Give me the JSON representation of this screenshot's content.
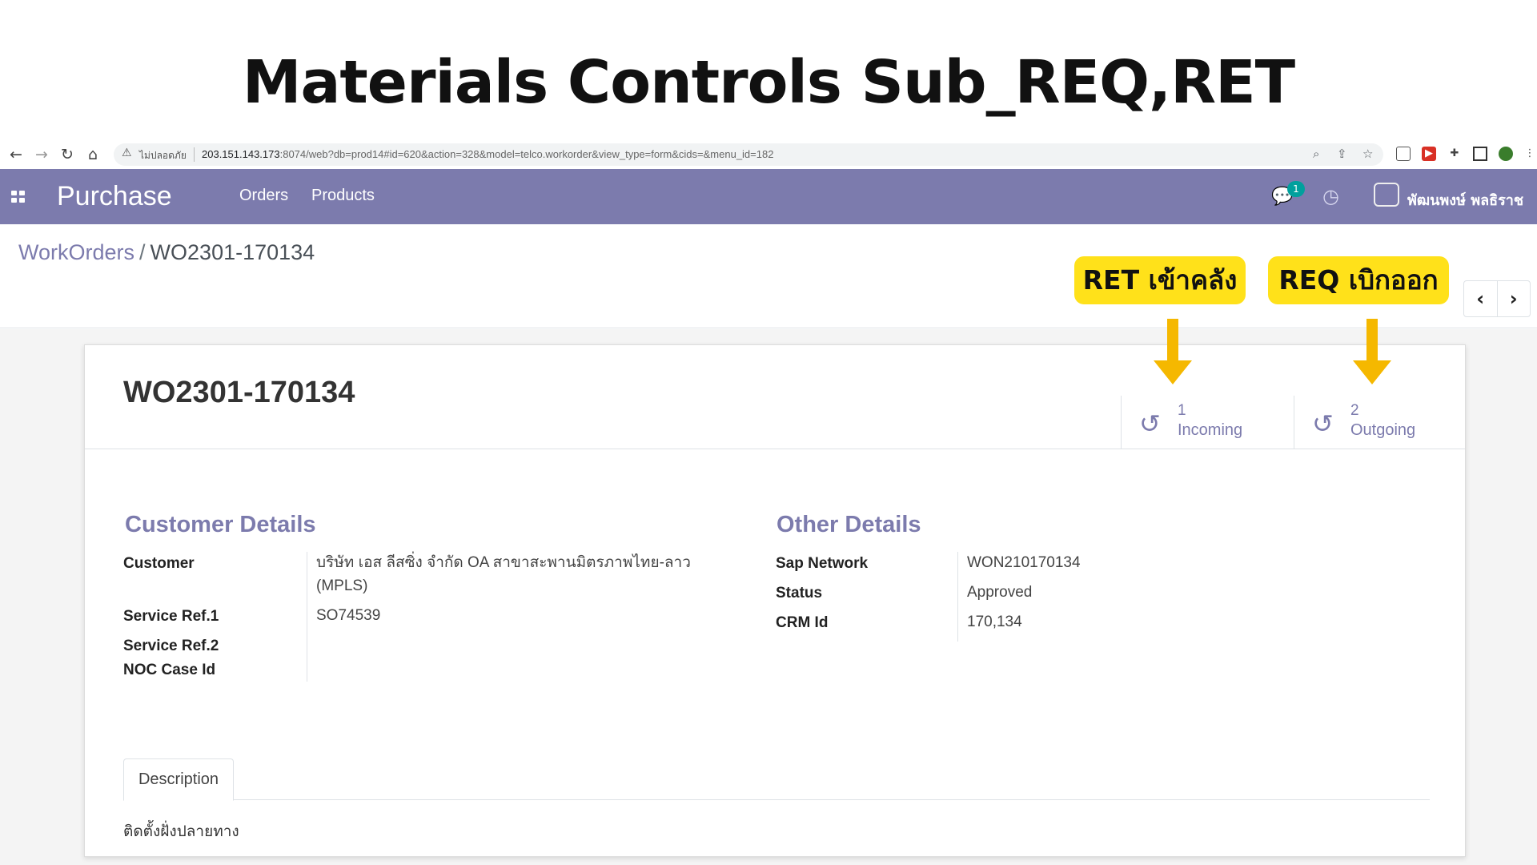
{
  "slide": {
    "title": "Materials Controls Sub_REQ,RET"
  },
  "browser": {
    "insecure_label": "ไม่ปลอดภัย",
    "url_host": "203.151.143.173",
    "url_path": ":8074/web?db=prod14#id=620&action=328&model=telco.workorder&view_type=form&cids=&menu_id=182"
  },
  "navbar": {
    "app_name": "Purchase",
    "menu": [
      "Orders",
      "Products"
    ],
    "chat_badge": "1",
    "user_name": "พัฒนพงษ์ พลธิราช"
  },
  "breadcrumb": {
    "parent": "WorkOrders",
    "separator": "/",
    "current": "WO2301-170134"
  },
  "callouts": {
    "ret": "RET เข้าคลัง",
    "req": "REQ เบิกออก"
  },
  "record": {
    "title": "WO2301-170134",
    "stats": [
      {
        "value": "1",
        "label": "Incoming"
      },
      {
        "value": "2",
        "label": "Outgoing"
      }
    ]
  },
  "customer_details": {
    "title": "Customer Details",
    "customer_label": "Customer",
    "customer_value": "บริษัท เอส ลีสซิ่ง จำกัด OA สาขาสะพานมิตรภาพไทย-ลาว (MPLS)",
    "service_ref1_label": "Service Ref.1",
    "service_ref1_value": "SO74539",
    "service_ref2_label": "Service Ref.2",
    "noc_case_label": "NOC Case Id"
  },
  "other_details": {
    "title": "Other Details",
    "sap_network_label": "Sap Network",
    "sap_network_value": "WON210170134",
    "status_label": "Status",
    "status_value": "Approved",
    "crm_id_label": "CRM Id",
    "crm_id_value": "170,134"
  },
  "tabs": {
    "description_label": "Description",
    "description_text": "ติดตั้งฝั่งปลายทาง"
  },
  "colors": {
    "brand": "#7c7bad",
    "callout": "#ffe11a",
    "arrow": "#f5b800",
    "badge": "#00a09d"
  }
}
